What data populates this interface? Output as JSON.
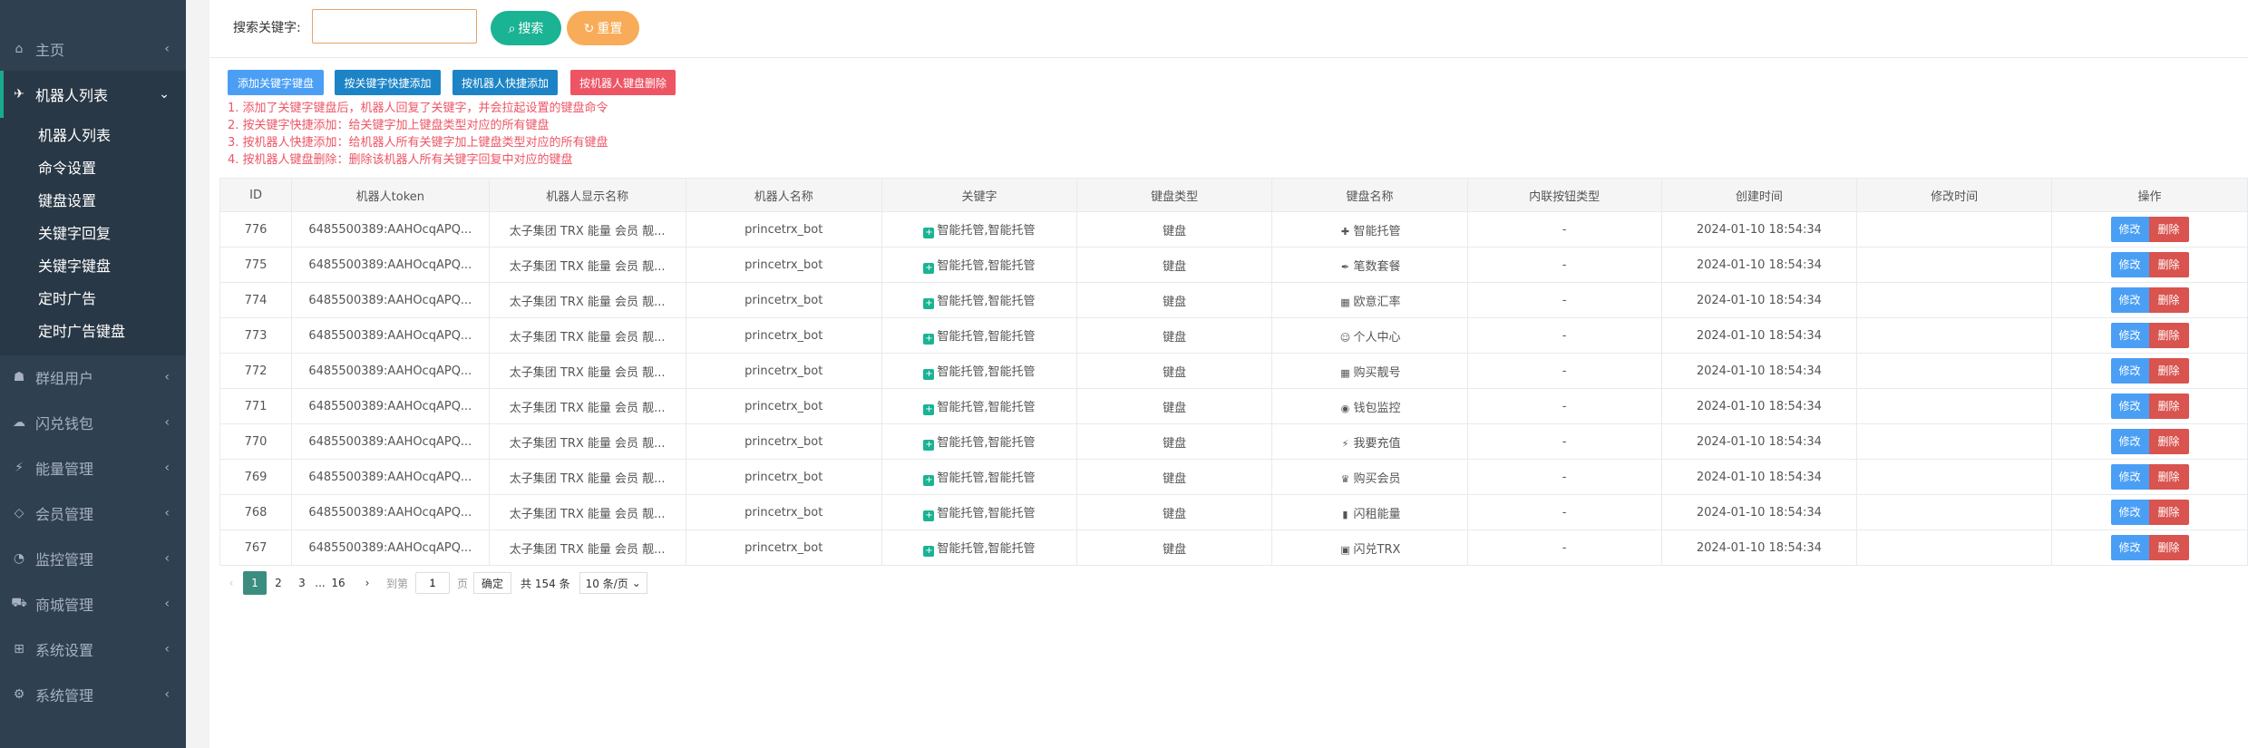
{
  "sidebar": {
    "items": [
      {
        "label": "主页",
        "icon": "home-icon"
      },
      {
        "label": "机器人列表",
        "icon": "plane-icon"
      },
      {
        "label": "群组用户",
        "icon": "users-icon"
      },
      {
        "label": "闪兑钱包",
        "icon": "cloud-icon"
      },
      {
        "label": "能量管理",
        "icon": "bolt-icon"
      },
      {
        "label": "会员管理",
        "icon": "diamond-icon"
      },
      {
        "label": "监控管理",
        "icon": "pie-icon"
      },
      {
        "label": "商城管理",
        "icon": "cart-icon"
      },
      {
        "label": "系统设置",
        "icon": "windows-icon"
      },
      {
        "label": "系统管理",
        "icon": "gear-icon"
      }
    ],
    "submenu": [
      "机器人列表",
      "命令设置",
      "键盘设置",
      "关键字回复",
      "关键字键盘",
      "定时广告",
      "定时广告键盘"
    ]
  },
  "search": {
    "label": "搜索关键字:",
    "placeholder": "",
    "search_btn": "搜索",
    "reset_btn": "重置"
  },
  "actions": {
    "add_kw_keyboard": "添加关键字键盘",
    "quick_by_kw": "按关键字快捷添加",
    "quick_by_bot": "按机器人快捷添加",
    "delete_by_bot": "按机器人键盘删除"
  },
  "notes": [
    "1. 添加了关键字键盘后，机器人回复了关键字，并会拉起设置的键盘命令",
    "2. 按关键字快捷添加：给关键字加上键盘类型对应的所有键盘",
    "3. 按机器人快捷添加：给机器人所有关键字加上键盘类型对应的所有键盘",
    "4. 按机器人键盘删除：删除该机器人所有关键字回复中对应的键盘"
  ],
  "table": {
    "headers": [
      "ID",
      "机器人token",
      "机器人显示名称",
      "机器人名称",
      "关键字",
      "键盘类型",
      "键盘名称",
      "内联按钮类型",
      "创建时间",
      "修改时间",
      "操作"
    ],
    "edit_label": "修改",
    "delete_label": "删除",
    "rows": [
      {
        "id": "776",
        "token": "6485500389:AAHOcqAPQ...",
        "display": "太子集团 TRX 能量 会员 靓...",
        "name": "princetrx_bot",
        "keyword": "智能托管,智能托管",
        "kb_type": "键盘",
        "kb_icon": "✚",
        "kb_name": "智能托管",
        "inline": "-",
        "created": "2024-01-10 18:54:34",
        "modified": ""
      },
      {
        "id": "775",
        "token": "6485500389:AAHOcqAPQ...",
        "display": "太子集团 TRX 能量 会员 靓...",
        "name": "princetrx_bot",
        "keyword": "智能托管,智能托管",
        "kb_type": "键盘",
        "kb_icon": "✒",
        "kb_name": "笔数套餐",
        "inline": "-",
        "created": "2024-01-10 18:54:34",
        "modified": ""
      },
      {
        "id": "774",
        "token": "6485500389:AAHOcqAPQ...",
        "display": "太子集团 TRX 能量 会员 靓...",
        "name": "princetrx_bot",
        "keyword": "智能托管,智能托管",
        "kb_type": "键盘",
        "kb_icon": "▦",
        "kb_name": "欧意汇率",
        "inline": "-",
        "created": "2024-01-10 18:54:34",
        "modified": ""
      },
      {
        "id": "773",
        "token": "6485500389:AAHOcqAPQ...",
        "display": "太子集团 TRX 能量 会员 靓...",
        "name": "princetrx_bot",
        "keyword": "智能托管,智能托管",
        "kb_type": "键盘",
        "kb_icon": "☺",
        "kb_name": "个人中心",
        "inline": "-",
        "created": "2024-01-10 18:54:34",
        "modified": ""
      },
      {
        "id": "772",
        "token": "6485500389:AAHOcqAPQ...",
        "display": "太子集团 TRX 能量 会员 靓...",
        "name": "princetrx_bot",
        "keyword": "智能托管,智能托管",
        "kb_type": "键盘",
        "kb_icon": "▦",
        "kb_name": "购买靓号",
        "inline": "-",
        "created": "2024-01-10 18:54:34",
        "modified": ""
      },
      {
        "id": "771",
        "token": "6485500389:AAHOcqAPQ...",
        "display": "太子集团 TRX 能量 会员 靓...",
        "name": "princetrx_bot",
        "keyword": "智能托管,智能托管",
        "kb_type": "键盘",
        "kb_icon": "◉",
        "kb_name": "钱包监控",
        "inline": "-",
        "created": "2024-01-10 18:54:34",
        "modified": ""
      },
      {
        "id": "770",
        "token": "6485500389:AAHOcqAPQ...",
        "display": "太子集团 TRX 能量 会员 靓...",
        "name": "princetrx_bot",
        "keyword": "智能托管,智能托管",
        "kb_type": "键盘",
        "kb_icon": "⚡",
        "kb_name": "我要充值",
        "inline": "-",
        "created": "2024-01-10 18:54:34",
        "modified": ""
      },
      {
        "id": "769",
        "token": "6485500389:AAHOcqAPQ...",
        "display": "太子集团 TRX 能量 会员 靓...",
        "name": "princetrx_bot",
        "keyword": "智能托管,智能托管",
        "kb_type": "键盘",
        "kb_icon": "♛",
        "kb_name": "购买会员",
        "inline": "-",
        "created": "2024-01-10 18:54:34",
        "modified": ""
      },
      {
        "id": "768",
        "token": "6485500389:AAHOcqAPQ...",
        "display": "太子集团 TRX 能量 会员 靓...",
        "name": "princetrx_bot",
        "keyword": "智能托管,智能托管",
        "kb_type": "键盘",
        "kb_icon": "▮",
        "kb_name": "闪租能量",
        "inline": "-",
        "created": "2024-01-10 18:54:34",
        "modified": ""
      },
      {
        "id": "767",
        "token": "6485500389:AAHOcqAPQ...",
        "display": "太子集团 TRX 能量 会员 靓...",
        "name": "princetrx_bot",
        "keyword": "智能托管,智能托管",
        "kb_type": "键盘",
        "kb_icon": "▣",
        "kb_name": "闪兑TRX",
        "inline": "-",
        "created": "2024-01-10 18:54:34",
        "modified": ""
      }
    ]
  },
  "pagination": {
    "pages": [
      "1",
      "2",
      "3",
      "...",
      "16"
    ],
    "current": "1",
    "goto_label": "到第",
    "goto_value": "1",
    "page_unit": "页",
    "confirm": "确定",
    "total": "共 154 条",
    "page_size": "10 条/页"
  }
}
